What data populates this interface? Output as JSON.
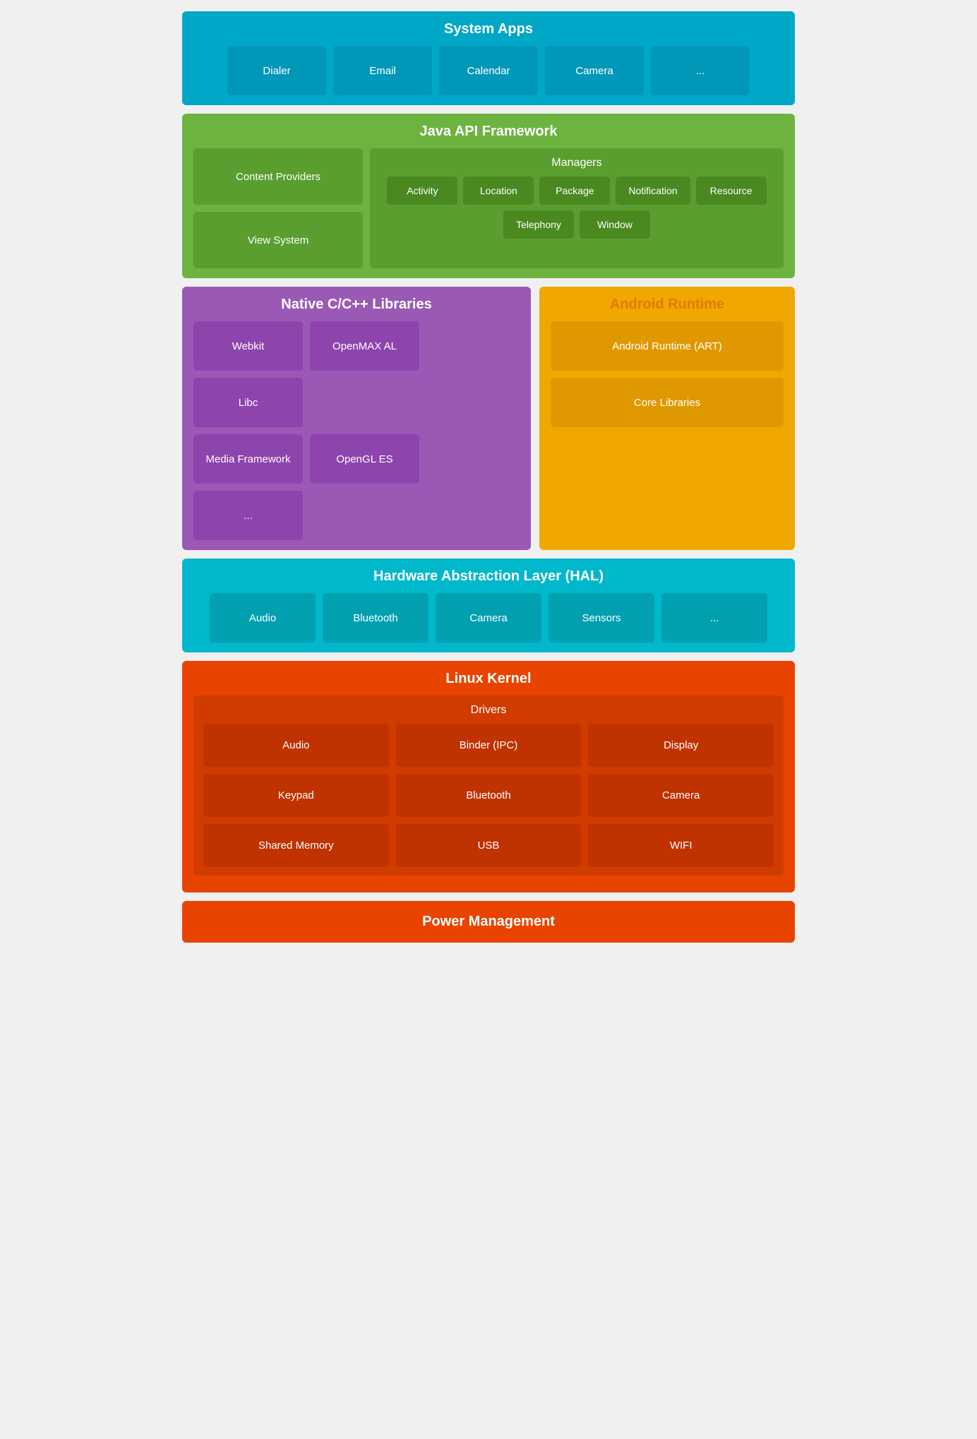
{
  "systemApps": {
    "title": "System Apps",
    "items": [
      "Dialer",
      "Email",
      "Calendar",
      "Camera",
      "..."
    ]
  },
  "javaApi": {
    "title": "Java API Framework",
    "left": [
      "Content Providers",
      "View System"
    ],
    "managers": {
      "title": "Managers",
      "row1": [
        "Activity",
        "Location",
        "Package",
        "Notification"
      ],
      "row2": [
        "Resource",
        "Telephony",
        "Window"
      ]
    }
  },
  "native": {
    "title": "Native C/C++ Libraries",
    "row1": [
      "Webkit",
      "OpenMAX AL",
      "Libc"
    ],
    "row2": [
      "Media Framework",
      "OpenGL ES",
      "..."
    ]
  },
  "runtime": {
    "title": "Android Runtime",
    "items": [
      "Android Runtime (ART)",
      "Core Libraries"
    ]
  },
  "hal": {
    "title": "Hardware Abstraction Layer (HAL)",
    "items": [
      "Audio",
      "Bluetooth",
      "Camera",
      "Sensors",
      "..."
    ]
  },
  "kernel": {
    "title": "Linux Kernel",
    "drivers": {
      "title": "Drivers",
      "items": [
        [
          "Audio",
          "Binder (IPC)",
          "Display"
        ],
        [
          "Keypad",
          "Bluetooth",
          "Camera"
        ],
        [
          "Shared Memory",
          "USB",
          "WIFI"
        ]
      ]
    }
  },
  "powerManagement": {
    "title": "Power Management"
  }
}
